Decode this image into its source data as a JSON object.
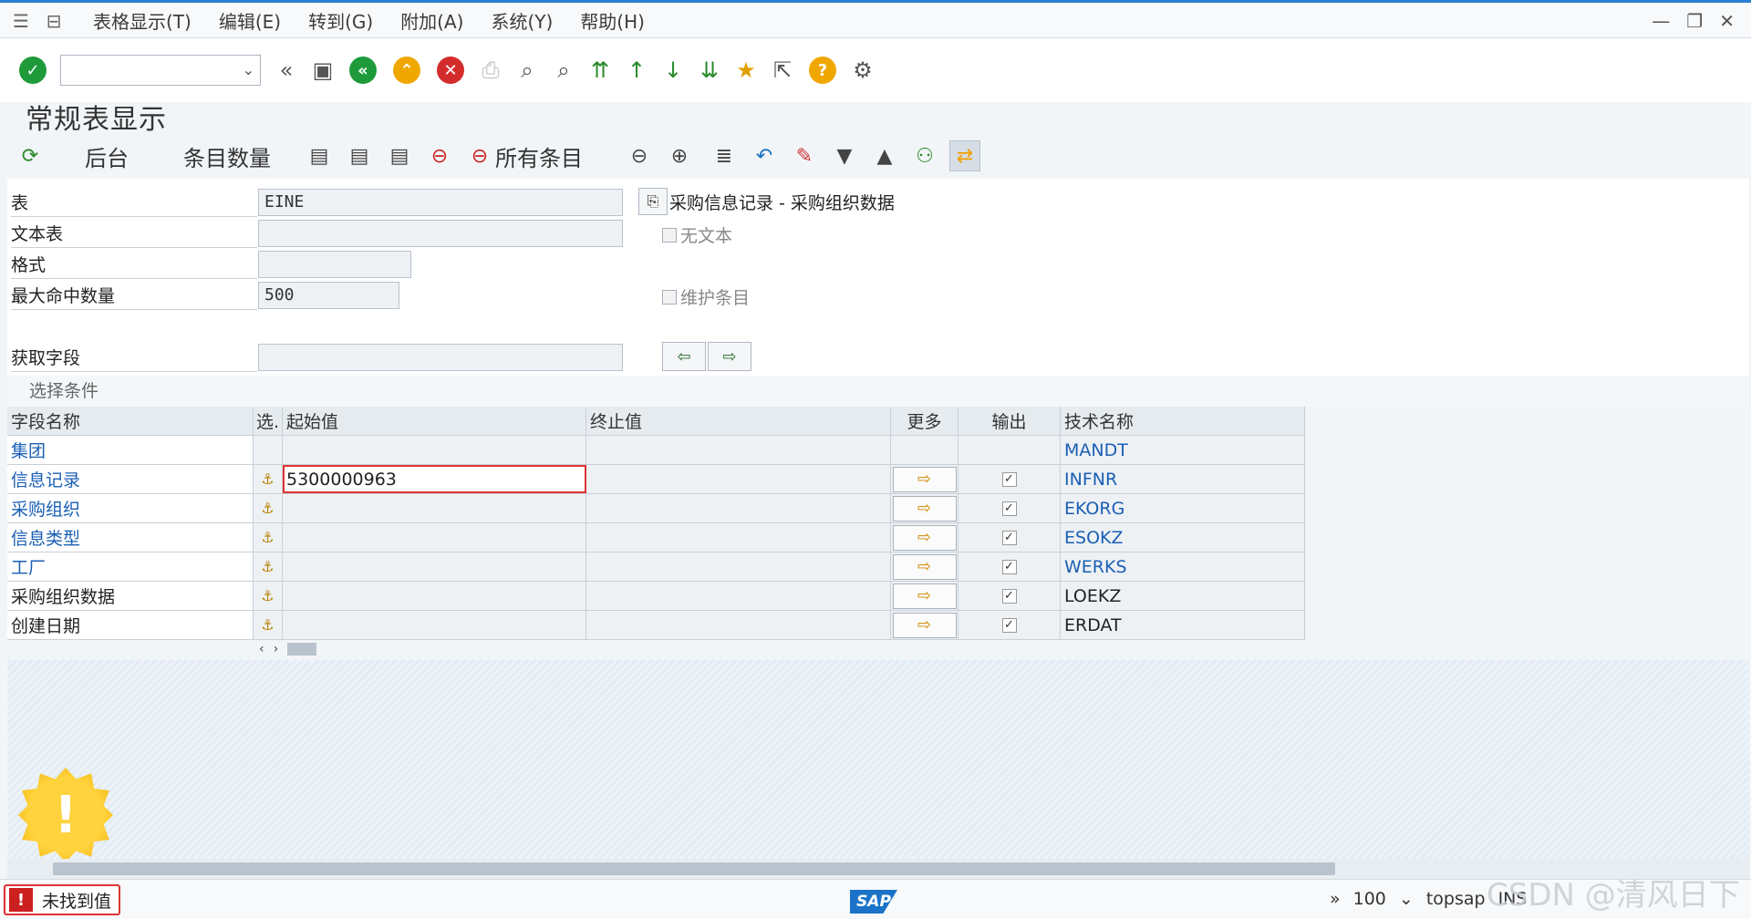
{
  "menu": {
    "items": [
      "表格显示(T)",
      "编辑(E)",
      "转到(G)",
      "附加(A)",
      "系统(Y)",
      "帮助(H)"
    ]
  },
  "command_field": {
    "value": ""
  },
  "page_title": "常规表显示",
  "app_toolbar": {
    "background": "后台",
    "entries_count": "条目数量",
    "all_entries": "所有条目"
  },
  "form": {
    "table_label": "表",
    "table_value": "EINE",
    "table_desc": "采购信息记录 - 采购组织数据",
    "text_table_label": "文本表",
    "text_table_value": "",
    "no_text_label": "无文本",
    "format_label": "格式",
    "format_value": "",
    "max_hits_label": "最大命中数量",
    "max_hits_value": "500",
    "maintain_entries_label": "维护条目",
    "fetch_fields_label": "获取字段",
    "fetch_fields_value": ""
  },
  "selection": {
    "title": "选择条件",
    "headers": [
      "字段名称",
      "选.",
      "起始值",
      "终止值",
      "更多",
      "输出",
      "技术名称"
    ],
    "rows": [
      {
        "name": "集团",
        "from": "",
        "to": "",
        "output": false,
        "tech": "MANDT",
        "link": true,
        "has_controls": false
      },
      {
        "name": "信息记录",
        "from": "5300000963",
        "to": "",
        "output": true,
        "tech": "INFNR",
        "link": true,
        "has_controls": true
      },
      {
        "name": "采购组织",
        "from": "",
        "to": "",
        "output": true,
        "tech": "EKORG",
        "link": true,
        "has_controls": true
      },
      {
        "name": "信息类型",
        "from": "",
        "to": "",
        "output": true,
        "tech": "ESOKZ",
        "link": true,
        "has_controls": true
      },
      {
        "name": "工厂",
        "from": "",
        "to": "",
        "output": true,
        "tech": "WERKS",
        "link": true,
        "has_controls": true
      },
      {
        "name": "采购组织数据",
        "from": "",
        "to": "",
        "output": true,
        "tech": "LOEKZ",
        "link": false,
        "has_controls": true
      },
      {
        "name": "创建日期",
        "from": "",
        "to": "",
        "output": true,
        "tech": "ERDAT",
        "link": false,
        "has_controls": true
      }
    ]
  },
  "status": {
    "message": "未找到值",
    "zoom": "100",
    "system": "topsap",
    "mode": "INS"
  },
  "watermark": "CSDN @清风日下",
  "colors": {
    "accent": "#2a7fd0",
    "link": "#1a5fb4",
    "error": "#cc1f1f",
    "warning": "#f0a800"
  }
}
